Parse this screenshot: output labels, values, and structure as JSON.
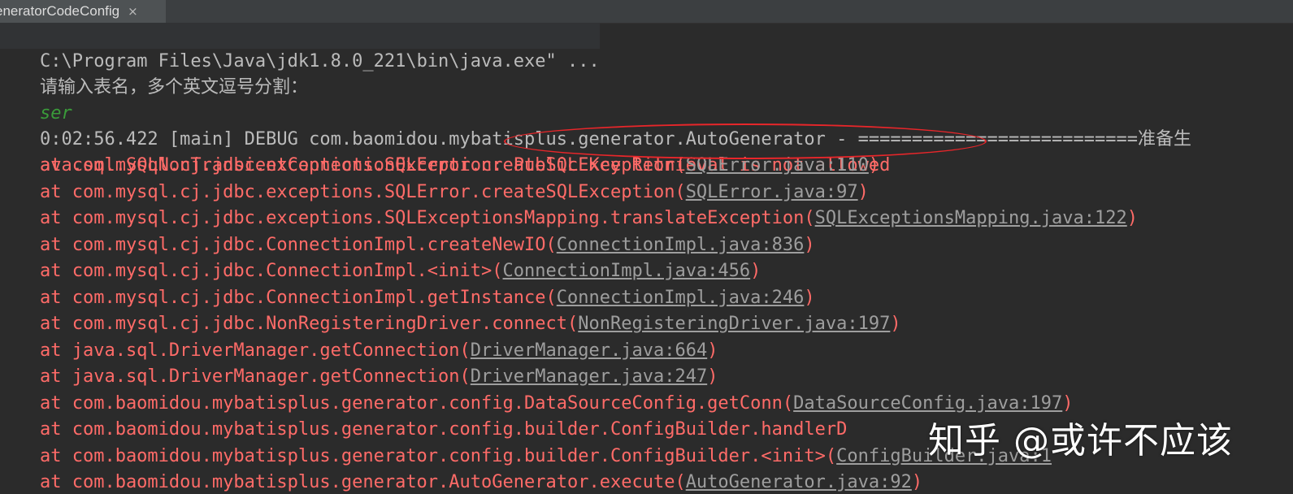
{
  "tab": {
    "title": "eneratorCodeConfig",
    "close": "×"
  },
  "console": {
    "command": "C:\\Program Files\\Java\\jdk1.8.0_221\\bin\\java.exe\" ...",
    "prompt": "请输入表名，多个英文逗号分割：",
    "input": "ser",
    "debug": "0:02:56.422 [main] DEBUG com.baomidou.mybatisplus.generator.AutoGenerator - ==========================准备生",
    "exception_class": "ava.sql.SQLNonTransientConnectionException:",
    "exception_message": " Public Key Retrieval is not allowed",
    "frames": [
      {
        "method": "    at com.mysql.cj.jdbc.exceptions.SQLError.createSQLException(",
        "link": "SQLError.java:110",
        "end": ")"
      },
      {
        "method": "    at com.mysql.cj.jdbc.exceptions.SQLError.createSQLException(",
        "link": "SQLError.java:97",
        "end": ")"
      },
      {
        "method": "    at com.mysql.cj.jdbc.exceptions.SQLExceptionsMapping.translateException(",
        "link": "SQLExceptionsMapping.java:122",
        "end": ")"
      },
      {
        "method": "    at com.mysql.cj.jdbc.ConnectionImpl.createNewIO(",
        "link": "ConnectionImpl.java:836",
        "end": ")"
      },
      {
        "method": "    at com.mysql.cj.jdbc.ConnectionImpl.<init>(",
        "link": "ConnectionImpl.java:456",
        "end": ")"
      },
      {
        "method": "    at com.mysql.cj.jdbc.ConnectionImpl.getInstance(",
        "link": "ConnectionImpl.java:246",
        "end": ")"
      },
      {
        "method": "    at com.mysql.cj.jdbc.NonRegisteringDriver.connect(",
        "link": "NonRegisteringDriver.java:197",
        "end": ")"
      },
      {
        "method": "    at java.sql.DriverManager.getConnection(",
        "link": "DriverManager.java:664",
        "end": ")"
      },
      {
        "method": "    at java.sql.DriverManager.getConnection(",
        "link": "DriverManager.java:247",
        "end": ")"
      },
      {
        "method": "    at com.baomidou.mybatisplus.generator.config.DataSourceConfig.getConn(",
        "link": "DataSourceConfig.java:197",
        "end": ")"
      },
      {
        "method": "    at com.baomidou.mybatisplus.generator.config.builder.ConfigBuilder.handlerD",
        "link": "",
        "end": ""
      },
      {
        "method": "    at com.baomidou.mybatisplus.generator.config.builder.ConfigBuilder.<init>(",
        "link": "ConfigBuilder.java:1",
        "end": ""
      },
      {
        "method": "    at com.baomidou.mybatisplus.generator.AutoGenerator.execute(",
        "link": "AutoGenerator.java:92",
        "end": ")"
      }
    ]
  },
  "watermark": "知乎 @或许不应该",
  "colors": {
    "background": "#2b2b2b",
    "error": "#ff6b68",
    "input": "#3a9b3a",
    "annotation": "#e8262a"
  }
}
